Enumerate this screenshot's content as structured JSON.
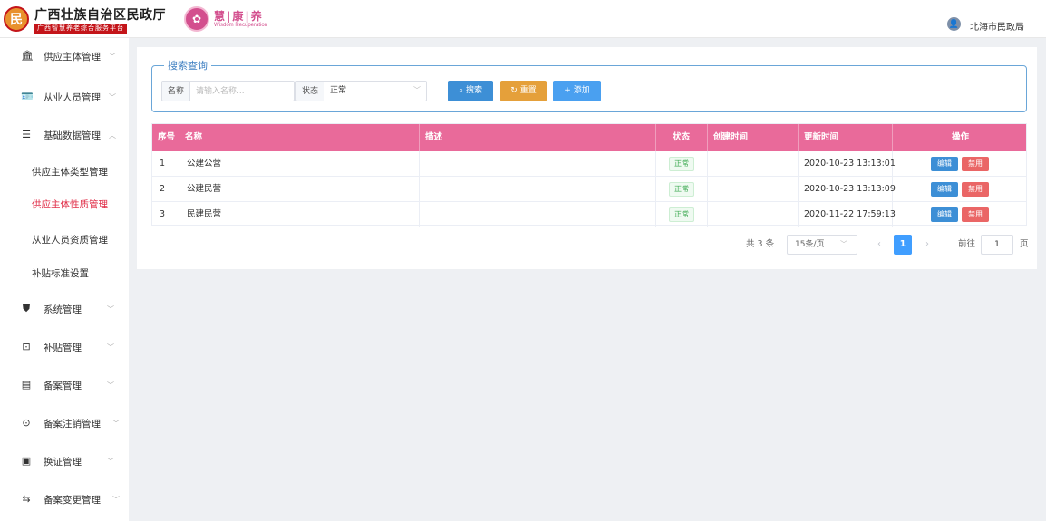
{
  "header": {
    "brand_title": "广西壮族自治区民政厅",
    "brand_subtitle": "广西智慧养老综合服务平台",
    "partner_name": "慧|康|养",
    "partner_subtitle": "Wisdom Recuperation",
    "user_name": "北海市民政局"
  },
  "sidebar": {
    "items": [
      {
        "label": "供应主体管理",
        "icon": "bank-icon",
        "expanded": false
      },
      {
        "label": "从业人员管理",
        "icon": "id-card-icon",
        "expanded": false
      },
      {
        "label": "基础数据管理",
        "icon": "document-icon",
        "expanded": true
      },
      {
        "label": "系统管理",
        "icon": "shield-icon",
        "expanded": false
      },
      {
        "label": "补贴管理",
        "icon": "box-icon",
        "expanded": false
      },
      {
        "label": "备案管理",
        "icon": "building-icon",
        "expanded": false
      },
      {
        "label": "备案注销管理",
        "icon": "circle-arrow-icon",
        "expanded": false
      },
      {
        "label": "换证管理",
        "icon": "certificate-icon",
        "expanded": false
      },
      {
        "label": "备案变更管理",
        "icon": "switch-icon",
        "expanded": false
      }
    ],
    "sub_items": [
      {
        "label": "供应主体类型管理",
        "active": false
      },
      {
        "label": "供应主体性质管理",
        "active": true
      },
      {
        "label": "从业人员资质管理",
        "active": false
      },
      {
        "label": "补贴标准设置",
        "active": false
      }
    ]
  },
  "search": {
    "legend": "搜索查询",
    "name_label": "名称",
    "name_placeholder": "请输入名称...",
    "name_value": "",
    "status_label": "状态",
    "status_value": "正常",
    "search_button": "搜索",
    "reset_button": "重置",
    "add_button": "添加"
  },
  "table": {
    "columns": [
      "序号",
      "名称",
      "描述",
      "状态",
      "创建时间",
      "更新时间",
      "操作"
    ],
    "rows": [
      {
        "index": "1",
        "name": "公建公营",
        "description": "",
        "status": "正常",
        "created": "",
        "updated": "2020-10-23 13:13:01"
      },
      {
        "index": "2",
        "name": "公建民营",
        "description": "",
        "status": "正常",
        "created": "",
        "updated": "2020-10-23 13:13:09"
      },
      {
        "index": "3",
        "name": "民建民营",
        "description": "",
        "status": "正常",
        "created": "",
        "updated": "2020-11-22 17:59:13"
      }
    ],
    "edit_label": "编辑",
    "disable_label": "禁用"
  },
  "pagination": {
    "total_text": "共 3 条",
    "page_size": "15条/页",
    "current_page": "1",
    "goto_label": "前往",
    "goto_value": "1",
    "page_unit": "页"
  },
  "colors": {
    "accent_pink": "#e96a9a",
    "active_red": "#e0304a",
    "primary_blue": "#3d8fd6",
    "reset_orange": "#e5a03a",
    "danger_red": "#ea6666"
  }
}
